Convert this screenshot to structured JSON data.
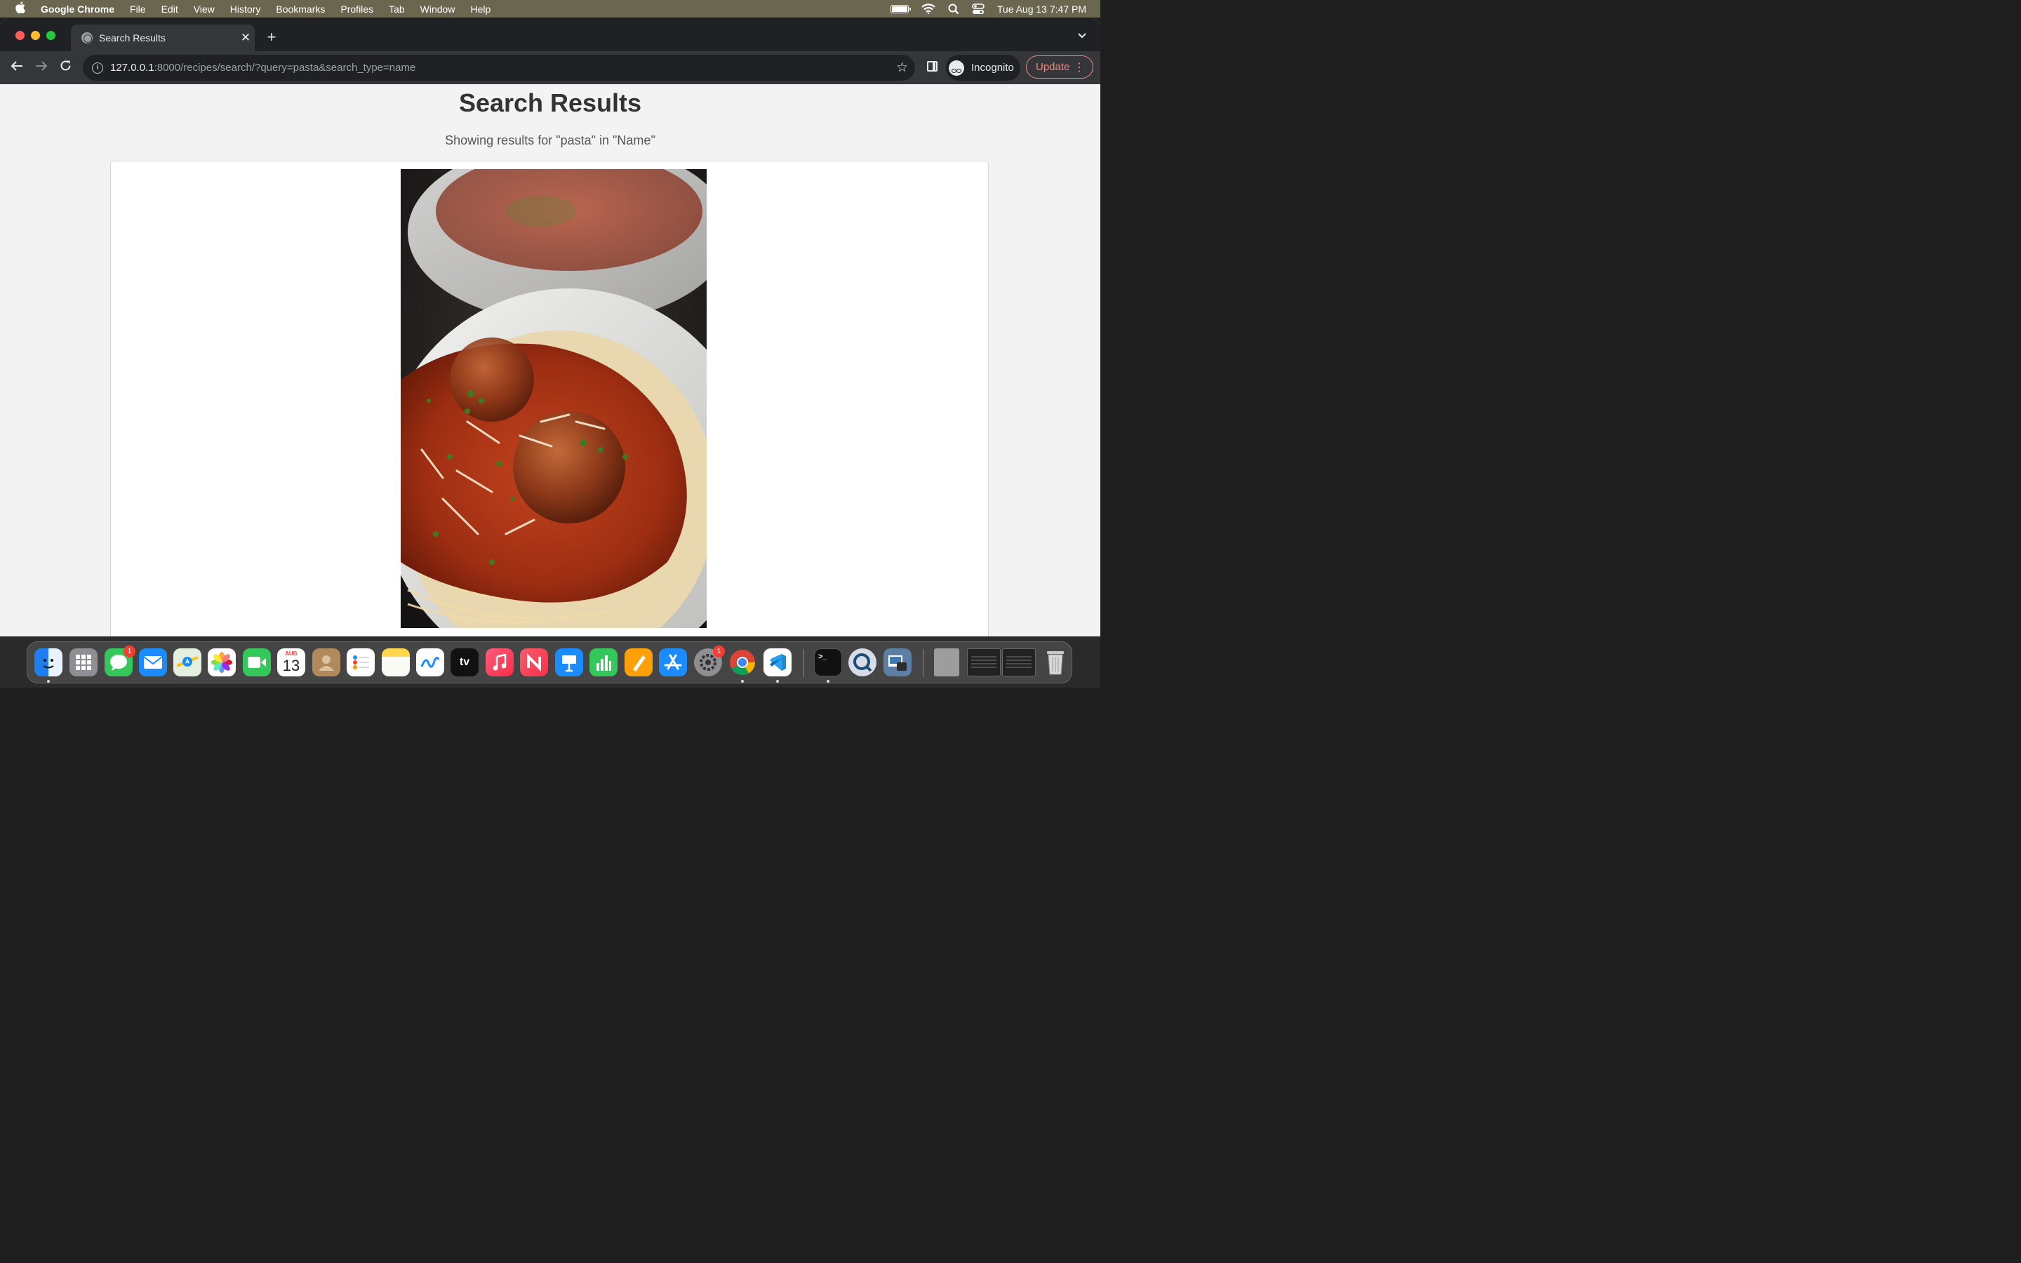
{
  "menubar": {
    "app_name": "Google Chrome",
    "items": [
      "File",
      "Edit",
      "View",
      "History",
      "Bookmarks",
      "Profiles",
      "Tab",
      "Window",
      "Help"
    ],
    "clock": "Tue Aug 13  7:47 PM"
  },
  "browser": {
    "tab_title": "Search Results",
    "url_host": "127.0.0.1",
    "url_rest": ":8000/recipes/search/?query=pasta&search_type=name",
    "profile_label": "Incognito",
    "update_label": "Update"
  },
  "page": {
    "heading": "Search Results",
    "subtitle": "Showing results for \"pasta\" in \"Name\""
  },
  "dock": {
    "apps": [
      "Finder",
      "Launchpad",
      "Messages",
      "Mail",
      "Maps",
      "Photos",
      "FaceTime",
      "Calendar",
      "Contacts",
      "Reminders",
      "Notes",
      "Freeform",
      "TV",
      "Music",
      "News",
      "Keynote",
      "Numbers",
      "Pages",
      "App Store",
      "System Settings",
      "Google Chrome",
      "Visual Studio Code",
      "Terminal",
      "QuickTime Player",
      "Preview"
    ],
    "calendar_month": "AUG",
    "calendar_day": "13",
    "tv_label": "tv",
    "messages_badge": "1",
    "settings_badge": "1"
  },
  "colors": {
    "menubar_bg": "#6a6650",
    "tab_strip": "#202124",
    "toolbar": "#35363a",
    "page_bg": "#f3f3f3",
    "update_accent": "#f28b82"
  }
}
